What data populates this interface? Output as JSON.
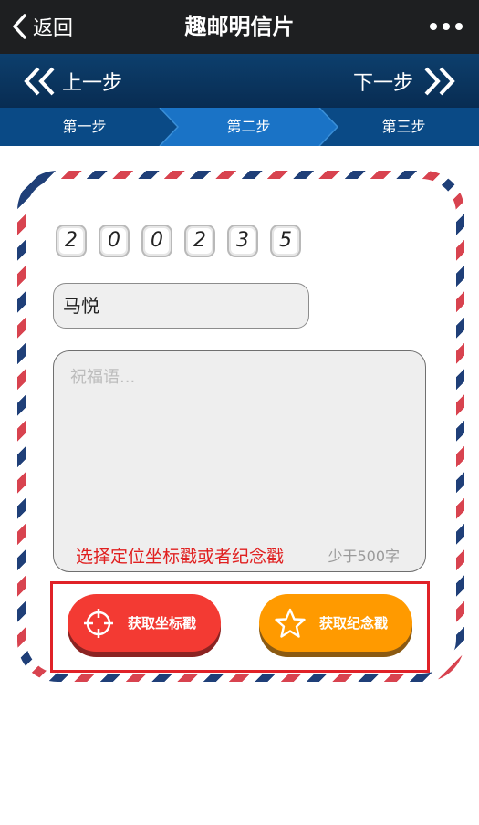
{
  "topbar": {
    "back_label": "返回",
    "title": "趣邮明信片"
  },
  "stepnav": {
    "prev_label": "上一步",
    "next_label": "下一步"
  },
  "steps": [
    {
      "label": "第一步"
    },
    {
      "label": "第二步"
    },
    {
      "label": "第三步"
    }
  ],
  "active_step": 2,
  "postcard": {
    "zip_digits": [
      "2",
      "0",
      "0",
      "2",
      "3",
      "5"
    ],
    "recipient_name": "马悦",
    "greeting_placeholder": "祝福语...",
    "stamp_hint": "选择定位坐标戳或者纪念戳",
    "char_limit": "少于500字"
  },
  "actions": {
    "location_stamp_label": "获取坐标戳",
    "commemorative_stamp_label": "获取纪念戳"
  },
  "colors": {
    "topbar_bg": "#1e1f21",
    "stepnav_bg": "#0a3560",
    "step_active": "#1a73c6",
    "step_inactive": "#0a4a86",
    "btn_location": "#f33a33",
    "btn_commemorative": "#ff9a00",
    "highlight_outline": "#e02228",
    "hint_text": "#e02020"
  }
}
